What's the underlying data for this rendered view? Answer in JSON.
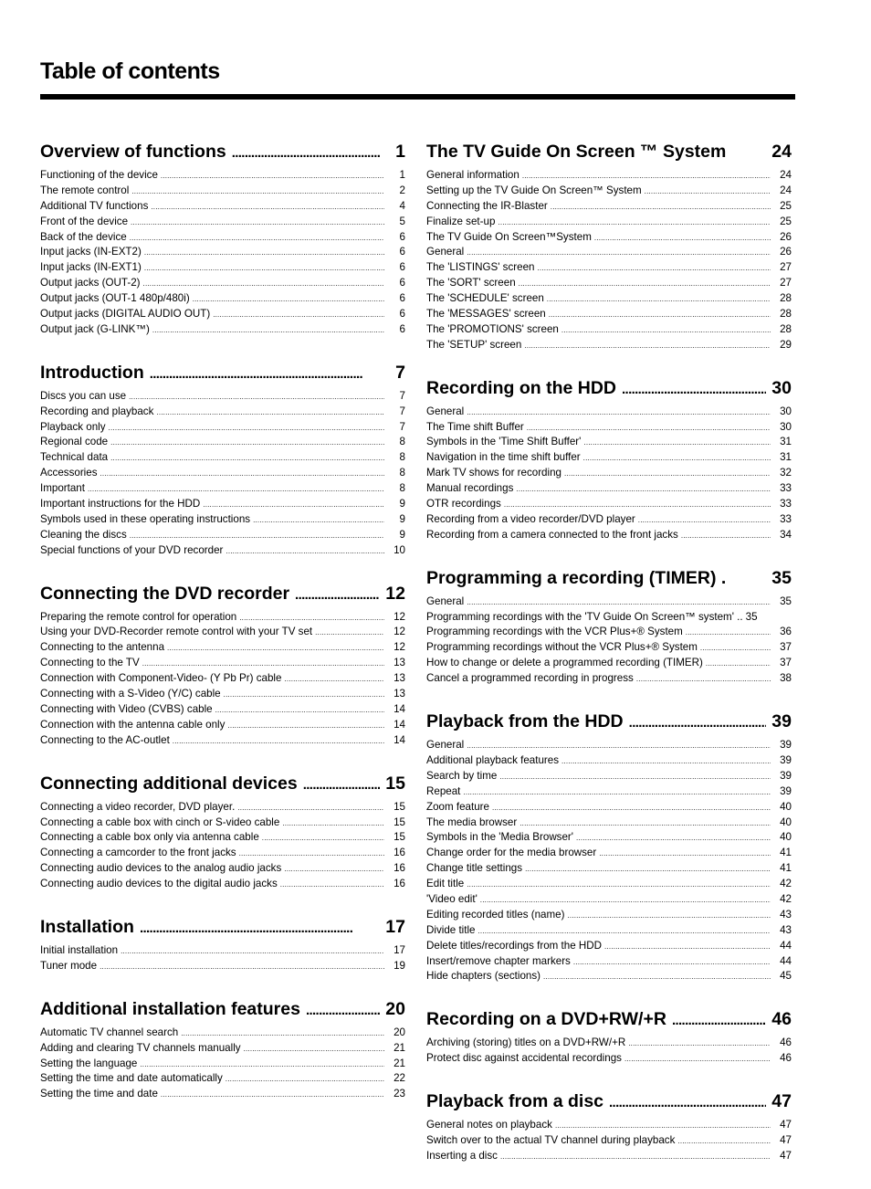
{
  "page": {
    "title": "Table of contents"
  },
  "left_column": [
    {
      "title": "Overview of functions",
      "page": "1",
      "entries": [
        {
          "title": "Functioning of the device",
          "page": "1"
        },
        {
          "title": "The remote control",
          "page": "2"
        },
        {
          "title": "Additional TV functions",
          "page": "4"
        },
        {
          "title": "Front of the device",
          "page": "5"
        },
        {
          "title": "Back of the device",
          "page": "6"
        },
        {
          "title": "Input jacks (IN-EXT2)",
          "page": "6"
        },
        {
          "title": "Input jacks (IN-EXT1)",
          "page": "6"
        },
        {
          "title": "Output jacks (OUT-2)",
          "page": "6"
        },
        {
          "title": "Output jacks (OUT-1   480p/480i)",
          "page": "6"
        },
        {
          "title": "Output jacks (DIGITAL AUDIO OUT)",
          "page": "6"
        },
        {
          "title": "Output jack (G-LINK™)",
          "page": "6"
        }
      ]
    },
    {
      "title": "Introduction",
      "page": "7",
      "entries": [
        {
          "title": "Discs you can use",
          "page": "7"
        },
        {
          "title": "Recording and playback",
          "page": "7"
        },
        {
          "title": "Playback only",
          "page": "7"
        },
        {
          "title": "Regional code",
          "page": "8"
        },
        {
          "title": "Technical data",
          "page": "8"
        },
        {
          "title": "Accessories",
          "page": "8"
        },
        {
          "title": "Important",
          "page": "8"
        },
        {
          "title": "Important instructions for the HDD",
          "page": "9"
        },
        {
          "title": "Symbols used in these operating instructions",
          "page": "9"
        },
        {
          "title": "Cleaning the discs",
          "page": "9"
        },
        {
          "title": "Special functions of your DVD recorder",
          "page": "10"
        }
      ]
    },
    {
      "title": "Connecting the DVD recorder",
      "page": "12",
      "entries": [
        {
          "title": "Preparing the remote control for operation",
          "page": "12"
        },
        {
          "title": "Using your DVD-Recorder remote control with your TV set",
          "page": "12"
        },
        {
          "title": "Connecting to the antenna",
          "page": "12"
        },
        {
          "title": "Connecting to the TV",
          "page": "13"
        },
        {
          "title": "Connection with Component-Video- (Y Pb Pr) cable",
          "page": "13"
        },
        {
          "title": "Connecting with a S-Video (Y/C) cable",
          "page": "13"
        },
        {
          "title": "Connecting with Video (CVBS) cable",
          "page": "14"
        },
        {
          "title": "Connection with the antenna cable only",
          "page": "14"
        },
        {
          "title": "Connecting to the AC-outlet",
          "page": "14"
        }
      ]
    },
    {
      "title": "Connecting additional devices",
      "page": "15",
      "entries": [
        {
          "title": "Connecting a video recorder, DVD player.",
          "page": "15"
        },
        {
          "title": "Connecting a cable box with cinch or S-video cable",
          "page": "15"
        },
        {
          "title": "Connecting a cable box only via antenna cable",
          "page": "15"
        },
        {
          "title": "Connecting a camcorder to the front jacks",
          "page": "16"
        },
        {
          "title": "Connecting audio devices to the analog audio jacks",
          "page": "16"
        },
        {
          "title": "Connecting audio devices to the digital audio jacks",
          "page": "16"
        }
      ]
    },
    {
      "title": "Installation",
      "page": "17",
      "entries": [
        {
          "title": "Initial installation",
          "page": "17"
        },
        {
          "title": "Tuner mode",
          "page": "19"
        }
      ]
    },
    {
      "title": "Additional installation features",
      "page": "20",
      "entries": [
        {
          "title": "Automatic TV channel search",
          "page": "20"
        },
        {
          "title": "Adding and clearing TV channels manually",
          "page": "21"
        },
        {
          "title": "Setting the language",
          "page": "21"
        },
        {
          "title": "Setting the time and date automatically",
          "page": "22"
        },
        {
          "title": "Setting the time and date",
          "page": "23"
        }
      ]
    }
  ],
  "right_column": [
    {
      "title": "The TV Guide On Screen ™ System",
      "page": "24",
      "nodots": true,
      "entries": [
        {
          "title": "General information",
          "page": "24"
        },
        {
          "title": "Setting up the TV Guide On Screen™ System",
          "page": "24"
        },
        {
          "title": "Connecting the IR-Blaster",
          "page": "25"
        },
        {
          "title": "Finalize set-up",
          "page": "25"
        },
        {
          "title": "The TV Guide On Screen™System",
          "page": "26"
        },
        {
          "title": "General",
          "page": "26"
        },
        {
          "title": "The 'LISTINGS' screen",
          "page": "27"
        },
        {
          "title": "The 'SORT' screen",
          "page": "27"
        },
        {
          "title": "The 'SCHEDULE' screen",
          "page": "28"
        },
        {
          "title": "The 'MESSAGES' screen",
          "page": "28"
        },
        {
          "title": "The 'PROMOTIONS' screen",
          "page": "28"
        },
        {
          "title": "The 'SETUP' screen",
          "page": "29"
        }
      ]
    },
    {
      "title": "Recording on the HDD",
      "page": "30",
      "entries": [
        {
          "title": "General",
          "page": "30"
        },
        {
          "title": "The Time shift Buffer",
          "page": "30"
        },
        {
          "title": "Symbols in the 'Time Shift Buffer'",
          "page": "31"
        },
        {
          "title": "Navigation in the time shift buffer",
          "page": "31"
        },
        {
          "title": "Mark TV shows for recording",
          "page": "32"
        },
        {
          "title": "Manual recordings",
          "page": "33"
        },
        {
          "title": "OTR recordings",
          "page": "33"
        },
        {
          "title": "Recording from a video recorder/DVD player",
          "page": "33"
        },
        {
          "title": "Recording from a camera connected to the front jacks",
          "page": "34"
        }
      ]
    },
    {
      "title": "Programming a recording (TIMER) .",
      "page": "35",
      "nodots": true,
      "entries": [
        {
          "title": "General",
          "page": "35"
        },
        {
          "title": "Programming recordings with the 'TV Guide On Screen™ system' ..",
          "page": "35"
        },
        {
          "title": "Programming recordings with the VCR Plus+® System",
          "page": "36"
        },
        {
          "title": "Programming recordings without the VCR Plus+® System",
          "page": "37"
        },
        {
          "title": "How to change or delete a programmed recording (TIMER)",
          "page": "37"
        },
        {
          "title": "Cancel a programmed recording in progress",
          "page": "38"
        }
      ]
    },
    {
      "title": "Playback from the HDD",
      "page": "39",
      "entries": [
        {
          "title": "General",
          "page": "39"
        },
        {
          "title": "Additional playback features",
          "page": "39"
        },
        {
          "title": "Search by time",
          "page": "39"
        },
        {
          "title": "Repeat",
          "page": "39"
        },
        {
          "title": "Zoom feature",
          "page": "40"
        },
        {
          "title": "The media browser",
          "page": "40"
        },
        {
          "title": "Symbols in the 'Media Browser'",
          "page": "40"
        },
        {
          "title": "Change order for the media browser",
          "page": "41"
        },
        {
          "title": "Change title settings",
          "page": "41"
        },
        {
          "title": "Edit title",
          "page": "42"
        },
        {
          "title": "'Video edit'",
          "page": "42"
        },
        {
          "title": "Editing recorded titles (name)",
          "page": "43"
        },
        {
          "title": "Divide title",
          "page": "43"
        },
        {
          "title": "Delete titles/recordings from the HDD",
          "page": "44"
        },
        {
          "title": "Insert/remove chapter markers",
          "page": "44"
        },
        {
          "title": "Hide chapters (sections)",
          "page": "45"
        }
      ]
    },
    {
      "title": "Recording on a DVD+RW/+R",
      "page": "46",
      "entries": [
        {
          "title": "Archiving (storing) titles on a DVD+RW/+R",
          "page": "46"
        },
        {
          "title": "Protect disc against accidental recordings",
          "page": "46"
        }
      ]
    },
    {
      "title": "Playback from a disc",
      "page": "47",
      "entries": [
        {
          "title": "General notes on playback",
          "page": "47"
        },
        {
          "title": "Switch over to the actual TV channel during playback",
          "page": "47"
        },
        {
          "title": "Inserting a disc",
          "page": "47"
        }
      ]
    }
  ]
}
